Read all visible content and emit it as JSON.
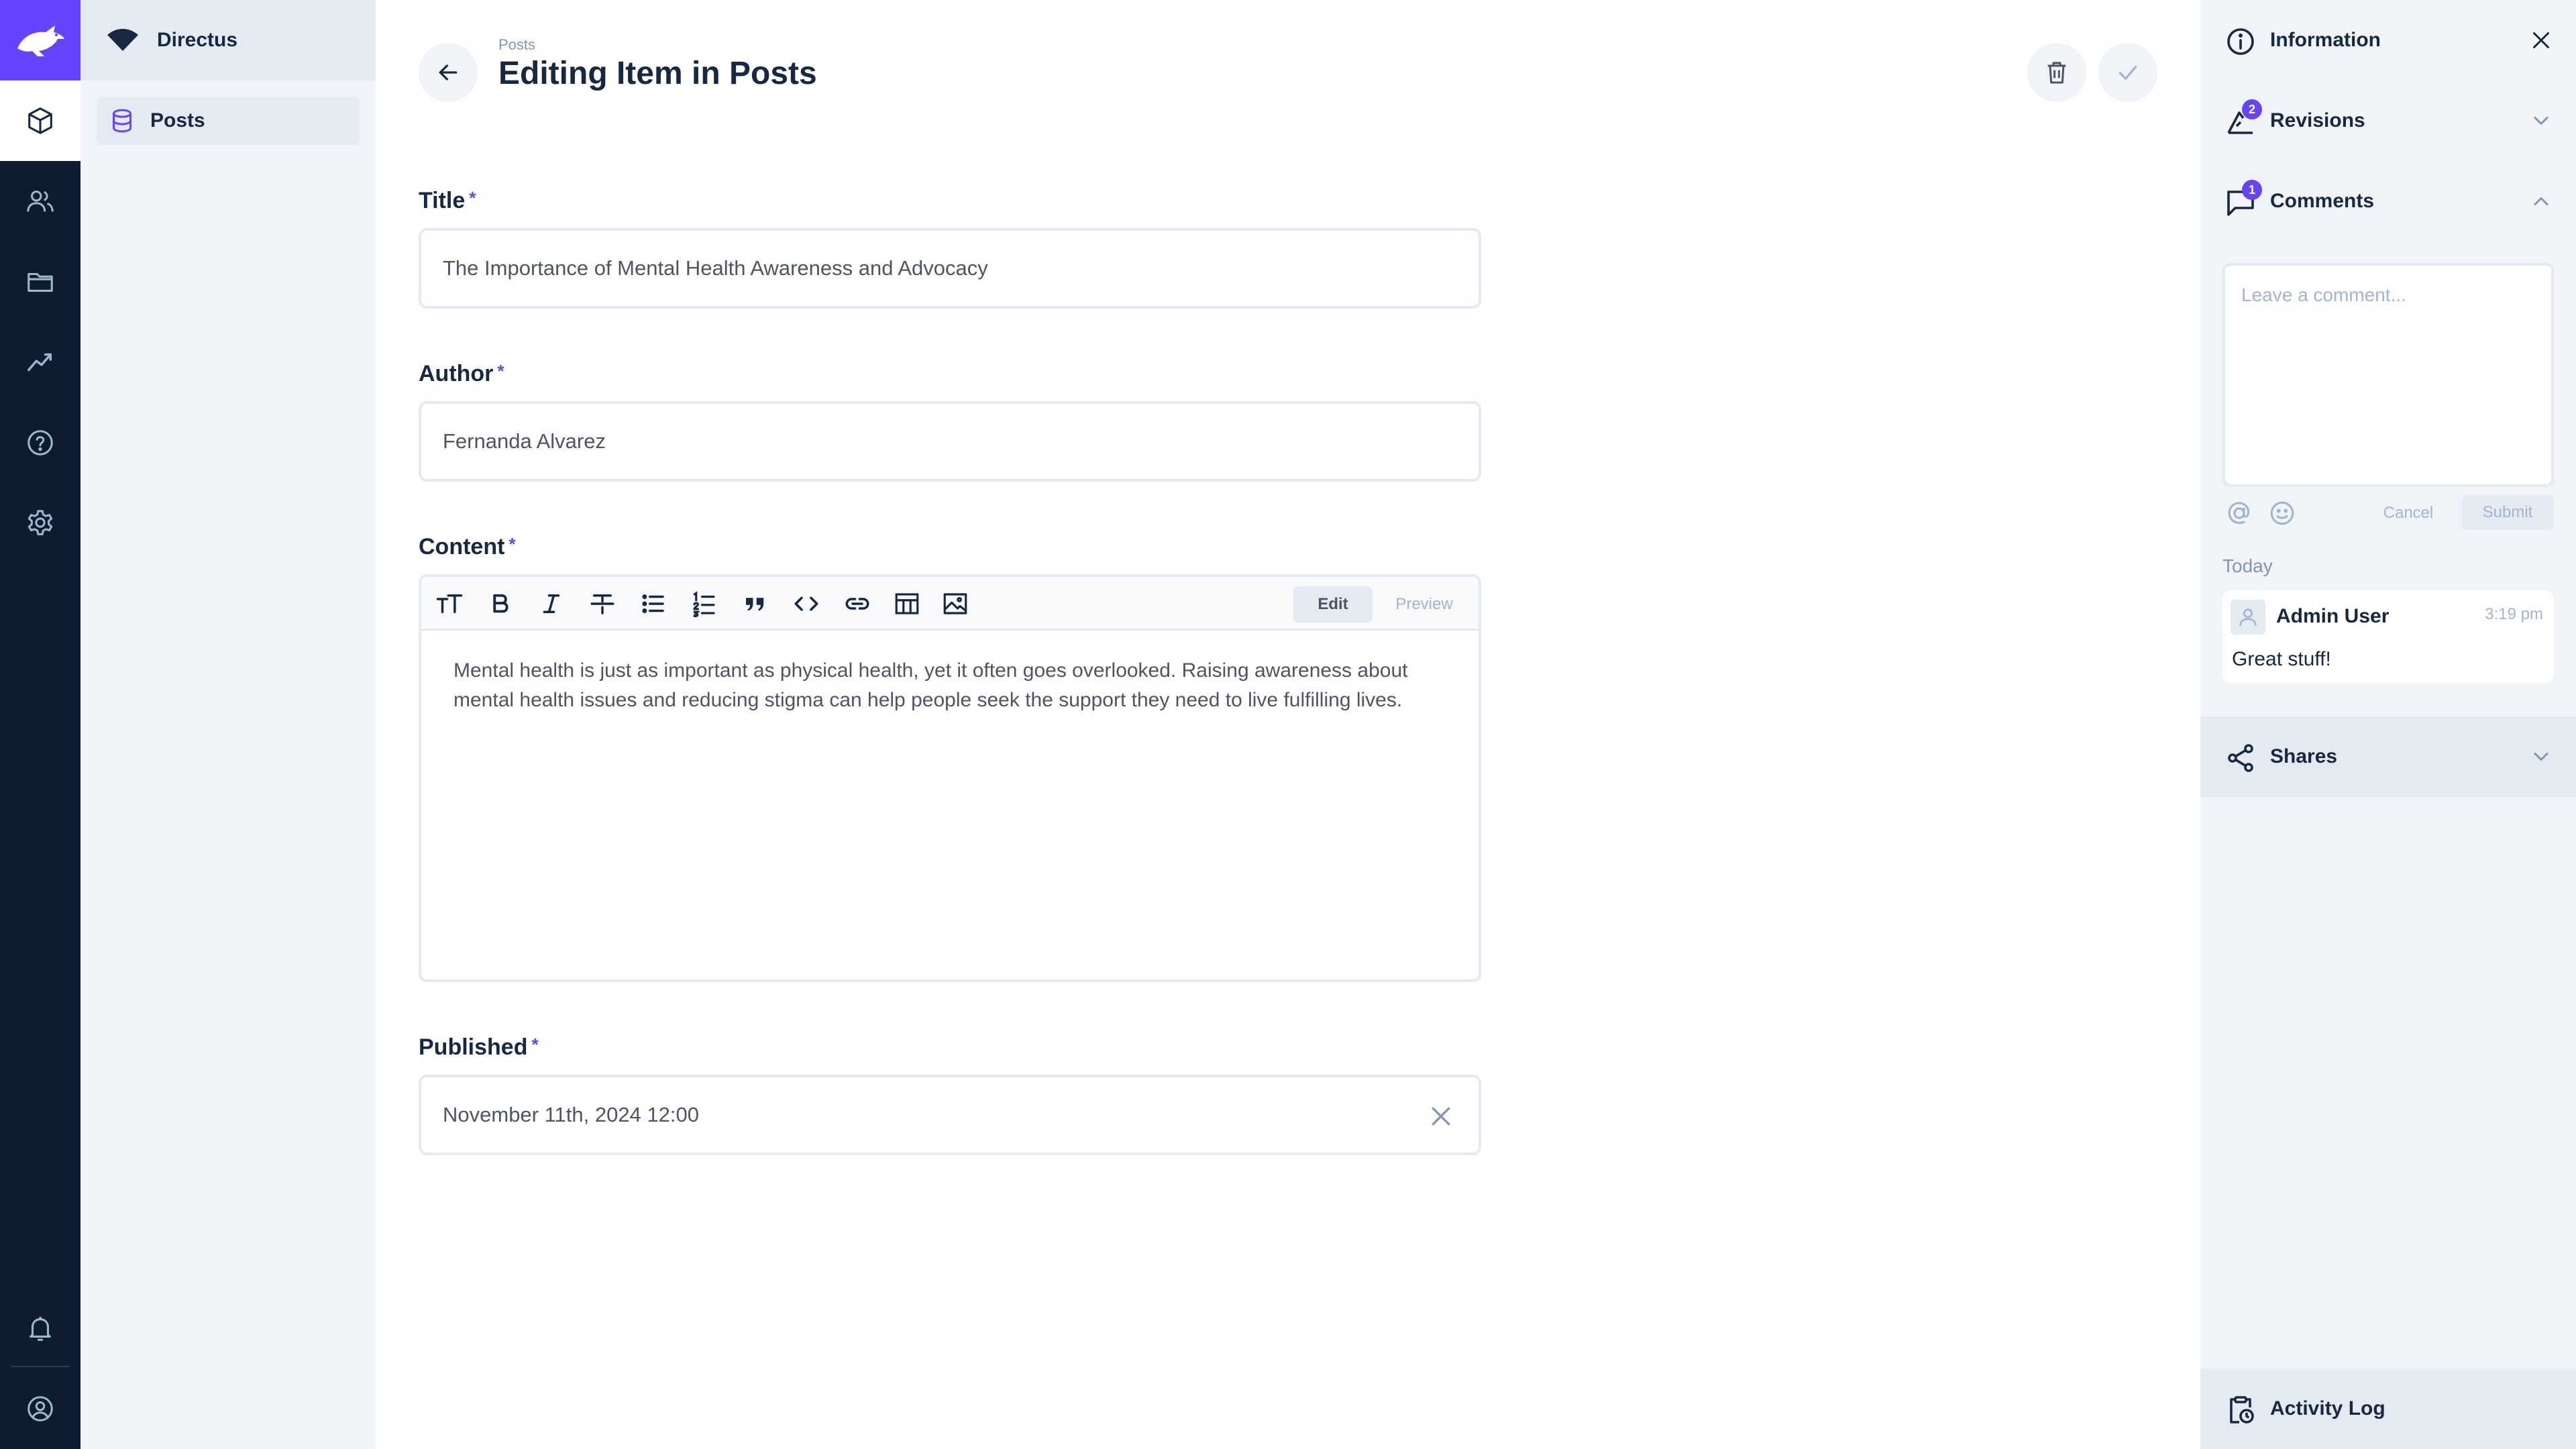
{
  "nav": {
    "project_name": "Directus",
    "items": [
      {
        "label": "Posts"
      }
    ]
  },
  "modules": [
    "content-icon",
    "users-icon",
    "files-icon",
    "insights-icon",
    "help-icon",
    "settings-icon",
    "notifications-icon",
    "user-profile-icon"
  ],
  "header": {
    "breadcrumb": "Posts",
    "title": "Editing Item in Posts"
  },
  "form": {
    "required_marker": "*",
    "title": {
      "label": "Title",
      "value": "The Importance of Mental Health Awareness and Advocacy"
    },
    "author": {
      "label": "Author",
      "value": "Fernanda Alvarez"
    },
    "content": {
      "label": "Content",
      "tab_edit": "Edit",
      "tab_preview": "Preview",
      "value": "Mental health is just as important as physical health, yet it often goes overlooked. Raising awareness about mental health issues and reducing stigma can help people seek the support they need to live fulfilling lives."
    },
    "published": {
      "label": "Published",
      "value": "November 11th, 2024 12:00"
    }
  },
  "sidebar": {
    "information": "Information",
    "revisions": {
      "label": "Revisions",
      "count": "2"
    },
    "comments": {
      "label": "Comments",
      "count": "1",
      "placeholder": "Leave a comment...",
      "cancel": "Cancel",
      "submit": "Submit",
      "day_label": "Today",
      "items": [
        {
          "author": "Admin User",
          "time": "3:19 pm",
          "text": "Great stuff!"
        }
      ]
    },
    "shares": "Shares",
    "activity_log": "Activity Log"
  },
  "colors": {
    "accent": "#6644ff",
    "module_bar": "#0e1c2f",
    "navigation_bg": "#f0f4f9",
    "text_primary": "#172940"
  }
}
